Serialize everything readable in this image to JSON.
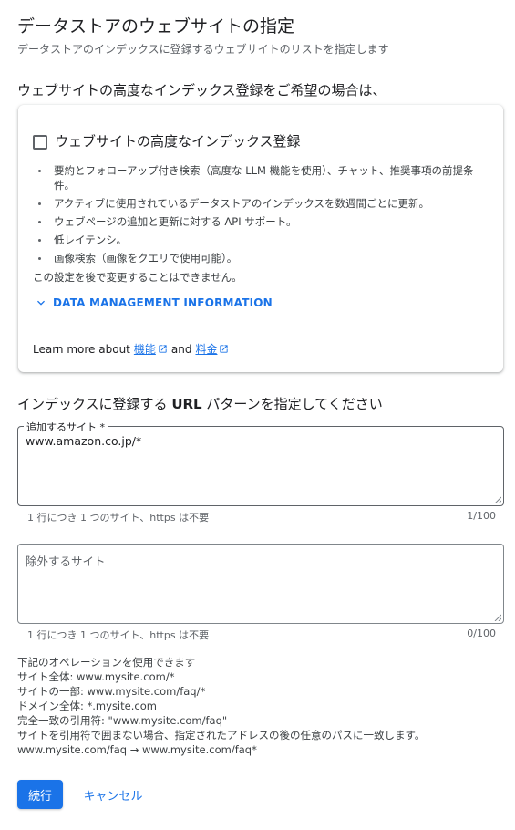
{
  "header": {
    "title": "データストアのウェブサイトの指定",
    "subtitle": "データストアのインデックスに登録するウェブサイトのリストを指定します"
  },
  "advanced": {
    "heading": "ウェブサイトの高度なインデックス登録をご希望の場合は、",
    "checkbox_label": "ウェブサイトの高度なインデックス登録",
    "checkbox_checked": false,
    "features": [
      "要約とフォローアップ付き検索（高度な LLM 機能を使用）、チャット、推奨事項の前提条件。",
      "アクティブに使用されているデータストアのインデックスを数週間ごとに更新。",
      "ウェブページの追加と更新に対する API サポート。",
      "低レイテンシ。",
      "画像検索（画像をクエリで使用可能）。"
    ],
    "warning": "この設定を後で変更することはできません。",
    "data_management_label": "DATA MANAGEMENT INFORMATION",
    "learn_more_prefix": "Learn more about",
    "link_features": "機能",
    "and_text": "and",
    "link_pricing": "料金"
  },
  "url_patterns": {
    "heading_pre": "インデックスに登録する ",
    "heading_bold": "URL",
    "heading_post": " パターンを指定してください",
    "include": {
      "label": "追加するサイト *",
      "value": "www.amazon.co.jp/*",
      "hint": "1 行につき 1 つのサイト、https は不要",
      "counter": "1/100"
    },
    "exclude": {
      "placeholder": "除外するサイト",
      "value": "",
      "hint": "1 行につき 1 つのサイト、https は不要",
      "counter": "0/100"
    }
  },
  "operations": {
    "lines": [
      "下記のオペレーションを使用できます",
      "サイト全体: www.mysite.com/*",
      "サイトの一部: www.mysite.com/faq/*",
      "ドメイン全体: *.mysite.com",
      "完全一致の引用符: \"www.mysite.com/faq\"",
      "サイトを引用符で囲まない場合、指定されたアドレスの後の任意のパスに一致します。",
      "www.mysite.com/faq → www.mysite.com/faq*"
    ]
  },
  "actions": {
    "continue_label": "続行",
    "cancel_label": "キャンセル"
  },
  "colors": {
    "accent": "#1a73e8",
    "text": "#202124",
    "secondary_text": "#5f6368"
  }
}
